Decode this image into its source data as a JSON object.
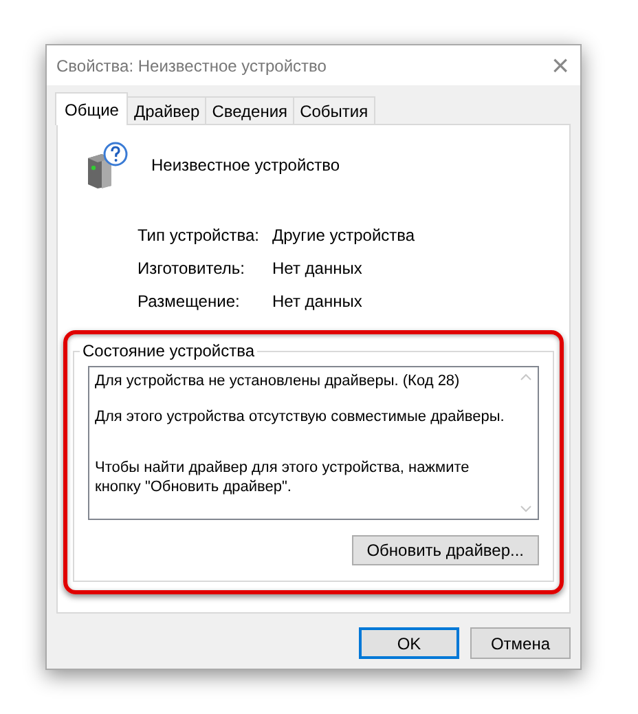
{
  "window": {
    "title": "Свойства: Неизвестное устройство",
    "close": "×"
  },
  "tabs": [
    {
      "label": "Общие",
      "selected": true
    },
    {
      "label": "Драйвер",
      "selected": false
    },
    {
      "label": "Сведения",
      "selected": false
    },
    {
      "label": "События",
      "selected": false
    }
  ],
  "device": {
    "name": "Неизвестное устройство"
  },
  "properties": [
    {
      "label": "Тип устройства:",
      "value": "Другие устройства"
    },
    {
      "label": "Изготовитель:",
      "value": "Нет данных"
    },
    {
      "label": "Размещение:",
      "value": "Нет данных"
    }
  ],
  "status": {
    "title": "Состояние устройства",
    "highlighted": true,
    "paragraphs": [
      "Для устройства не установлены драйверы. (Код 28)",
      "Для этого устройства отсутствую совместимые драйверы.",
      "Чтобы найти драйвер для этого устройства, нажмите кнопку \"Обновить драйвер\"."
    ],
    "button": "Обновить драйвер..."
  },
  "buttons": [
    {
      "label": "OK",
      "selected": true
    },
    {
      "label": "Отмена",
      "selected": false
    }
  ]
}
